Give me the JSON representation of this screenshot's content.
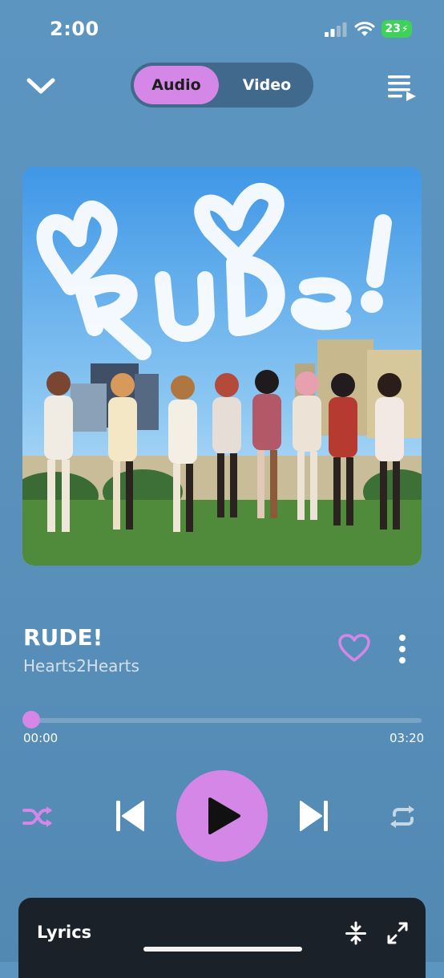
{
  "status_bar": {
    "time": "2:00",
    "battery": "23"
  },
  "mode_toggle": {
    "audio_label": "Audio",
    "video_label": "Video",
    "selected": "Audio"
  },
  "track": {
    "title": "RUDE!",
    "artist": "Hearts2Hearts",
    "liked": false
  },
  "progress": {
    "current": "00:00",
    "duration": "03:20",
    "fraction": 0
  },
  "lyrics_panel": {
    "label": "Lyrics"
  },
  "colors": {
    "accent": "#d487e6",
    "background": "#5a92bd",
    "panel": "#1b2129"
  },
  "icons": [
    "chevron-down-icon",
    "queue-icon",
    "heart-icon",
    "more-icon",
    "shuffle-icon",
    "previous-icon",
    "play-icon",
    "next-icon",
    "repeat-icon",
    "compress-icon",
    "expand-icon"
  ]
}
